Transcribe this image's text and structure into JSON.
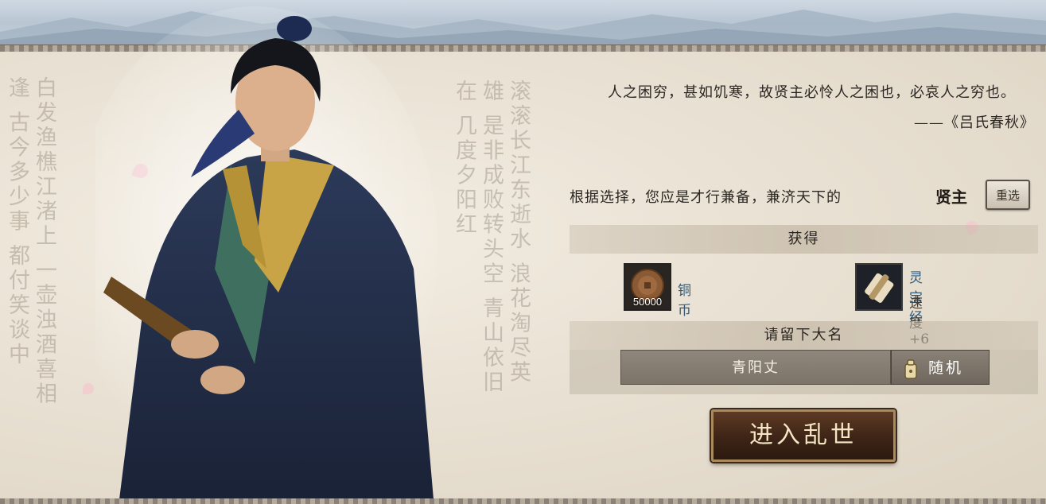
{
  "quote": {
    "text": "人之困穷，甚如饥寒，故贤主必怜人之困也，必哀人之穷也。",
    "source": "——《吕氏春秋》"
  },
  "result": {
    "line": "根据选择，您应是才行兼备，兼济天下的",
    "title": "贤主",
    "reselect_label": "重选"
  },
  "rewards": {
    "header": "获得",
    "items": [
      {
        "name": "铜币",
        "amount": "50000",
        "icon": "copper-coin-icon"
      },
      {
        "name": "灵宝经",
        "stat": "速度+6",
        "icon": "scroll-icon"
      }
    ]
  },
  "naming": {
    "header": "请留下大名",
    "value": "青阳丈",
    "random_label": "随机"
  },
  "enter_label": "进入乱世",
  "calligraphy": {
    "left": [
      "白发渔樵江渚上",
      "一壶浊酒喜相逢",
      "古今多少事",
      "都付笑谈中"
    ],
    "right": [
      "滚滚长江东逝水",
      "浪花淘尽英雄",
      "是非成败转头空",
      "青山依旧在",
      "几度夕阳红"
    ]
  },
  "colors": {
    "accent_dark": "#3d2416",
    "gold_border": "#a88a5c",
    "reward_name": "#2f5a7a"
  }
}
